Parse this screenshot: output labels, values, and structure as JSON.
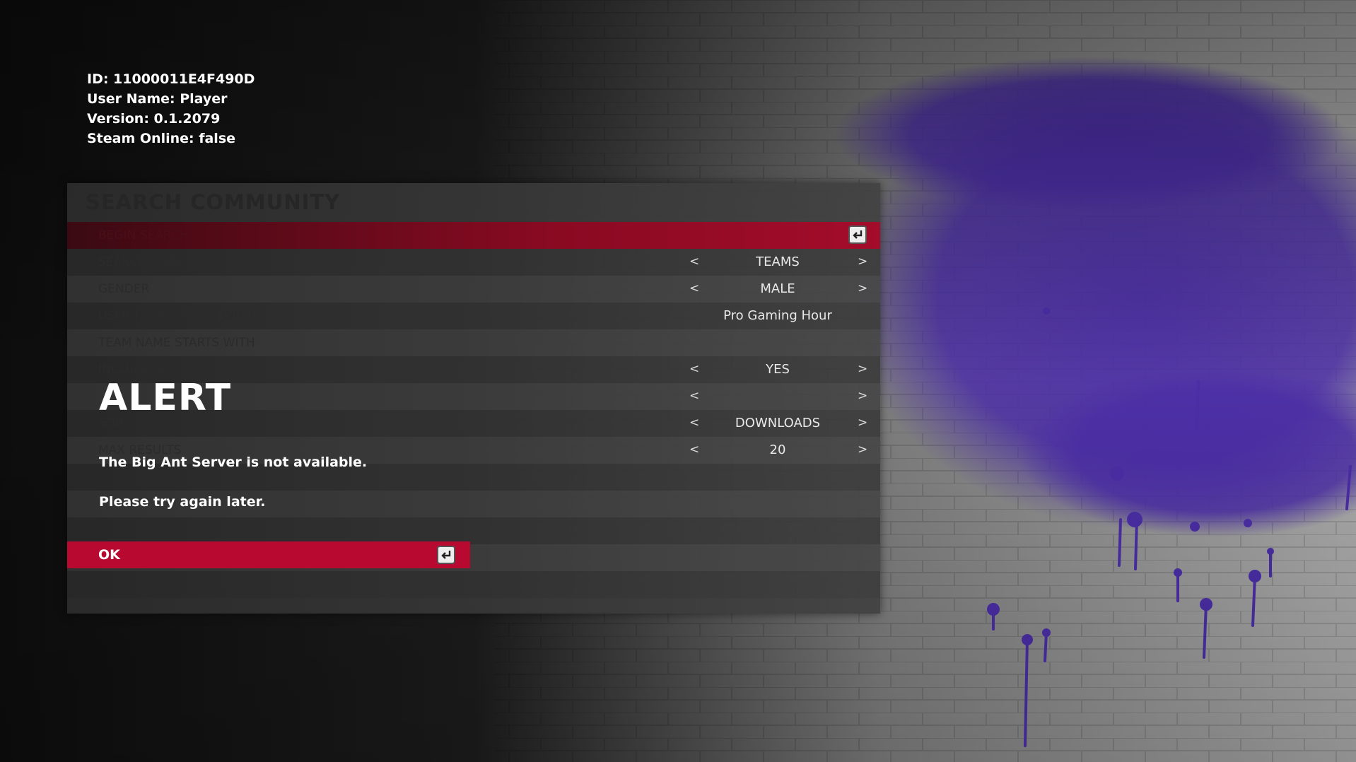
{
  "player_info": {
    "id": "ID: 11000011E4F490D",
    "user_name": "User Name: Player",
    "version": "Version: 0.1.2079",
    "steam_online": "Steam Online: false"
  },
  "panel": {
    "title": "SEARCH COMMUNITY",
    "rows": [
      {
        "label": "BEGIN SEARCH",
        "value": ""
      },
      {
        "label": "SEARCH TYPE",
        "value": "TEAMS"
      },
      {
        "label": "GENDER",
        "value": "MALE"
      },
      {
        "label": "USER NAME STARTS WITH",
        "value": "Pro Gaming Hour"
      },
      {
        "label": "TEAM NAME STARTS WITH",
        "value": ""
      },
      {
        "label": "INCLUDE LOGOS",
        "value": "YES"
      },
      {
        "label": "",
        "value": ""
      },
      {
        "label": "SORT BY",
        "value": "DOWNLOADS"
      },
      {
        "label": "MAX RESULTS",
        "value": "20"
      }
    ],
    "arrow_left": "<",
    "arrow_right": ">"
  },
  "alert": {
    "title": "ALERT",
    "message_line1": "The Big Ant Server is not available.",
    "message_line2": "Please try again later.",
    "ok_label": "OK"
  },
  "colors": {
    "accent_red": "#b80a30",
    "spray_purple": "#4a2fa0"
  }
}
